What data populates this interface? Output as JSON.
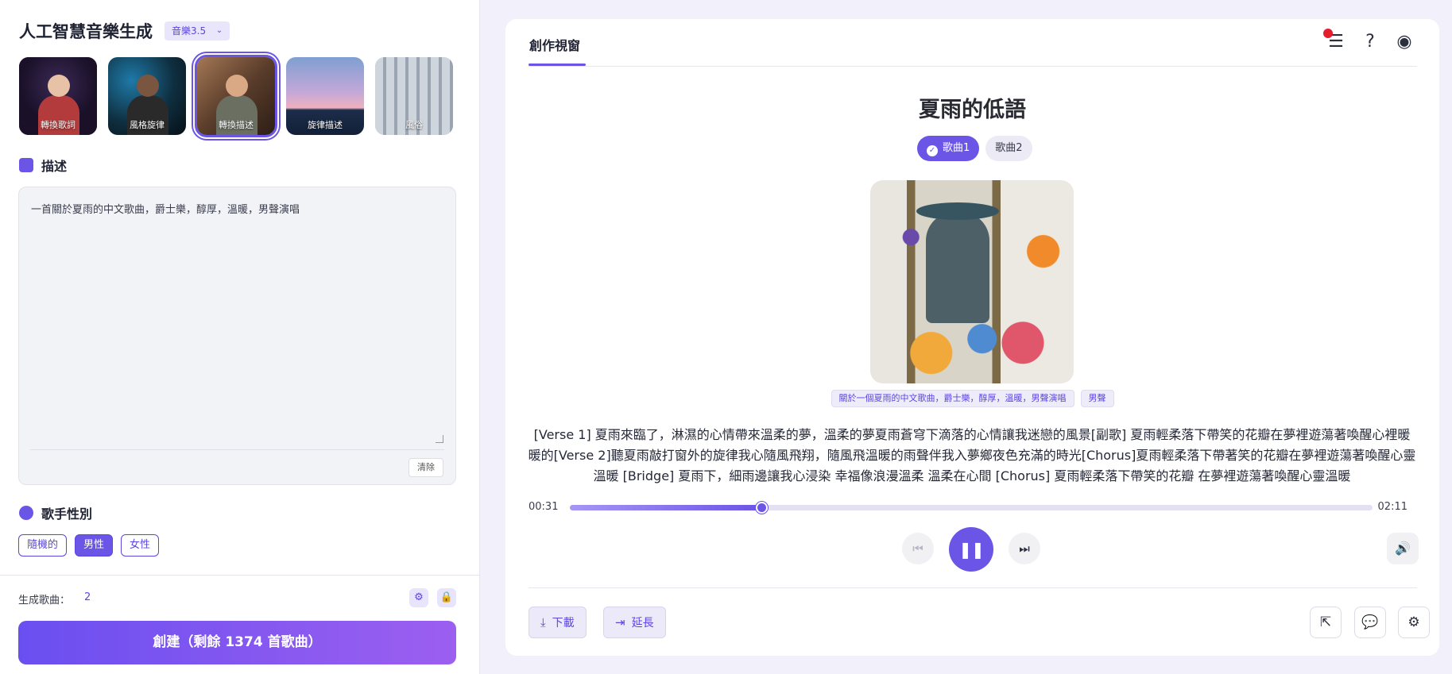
{
  "sidebar": {
    "app_title": "人工智慧音樂生成",
    "model_selected": "音樂3.5",
    "presets": [
      {
        "label": "轉換歌詞",
        "active": false
      },
      {
        "label": "風格旋律",
        "active": false
      },
      {
        "label": "轉換描述",
        "active": true
      },
      {
        "label": "旋律描述",
        "active": false
      },
      {
        "label": "風俗",
        "active": false
      }
    ],
    "description_heading": "描述",
    "description_value": "一首關於夏雨的中文歌曲，爵士樂，醇厚，溫暖，男聲演唱",
    "clear_label": "清除",
    "gender_heading": "歌手性別",
    "gender_options": [
      "隨機的",
      "男性",
      "女性"
    ],
    "gender_selected": "男性",
    "songs_label": "生成歌曲：",
    "songs_count": "2",
    "create_label": "創建（剩餘 1374 首歌曲）"
  },
  "workspace": {
    "tab_label": "創作視窗",
    "song_title": "夏雨的低語",
    "song_tabs": [
      {
        "label": "歌曲1",
        "selected": true
      },
      {
        "label": "歌曲2",
        "selected": false
      }
    ],
    "tags": [
      "關於一個夏雨的中文歌曲，爵士樂，醇厚，溫暖，男聲演唱",
      "男聲"
    ],
    "lyrics": "[Verse 1] 夏雨來臨了，淋濕的心情帶來溫柔的夢，溫柔的夢夏雨蒼穹下滴落的心情讓我迷戀的風景[副歌] 夏雨輕柔落下帶笑的花瓣在夢裡遊蕩著喚醒心裡暖暖的[Verse 2]聽夏雨敲打窗外的旋律我心隨風飛翔，隨風飛溫暖的雨聲伴我入夢鄉夜色充滿的時光[Chorus]夏雨輕柔落下帶著笑的花瓣在夢裡遊蕩著喚醒心靈溫暖 [Bridge] 夏雨下，細雨邊讓我心浸染 幸福像浪漫溫柔 溫柔在心間 [Chorus] 夏雨輕柔落下帶笑的花瓣 在夢裡遊蕩著喚醒心靈溫暖",
    "player": {
      "current_time": "00:31",
      "total_time": "02:11",
      "progress": 0.24
    },
    "download_label": "下載",
    "extend_label": "延長"
  },
  "icons": {
    "queue": "queue-list-icon",
    "help": "help-icon",
    "discord": "discord-icon",
    "share": "share-icon",
    "comment": "comment-icon",
    "settings": "settings-icon"
  },
  "colors": {
    "accent": "#6a55e6",
    "notification": "#e51e2e"
  }
}
